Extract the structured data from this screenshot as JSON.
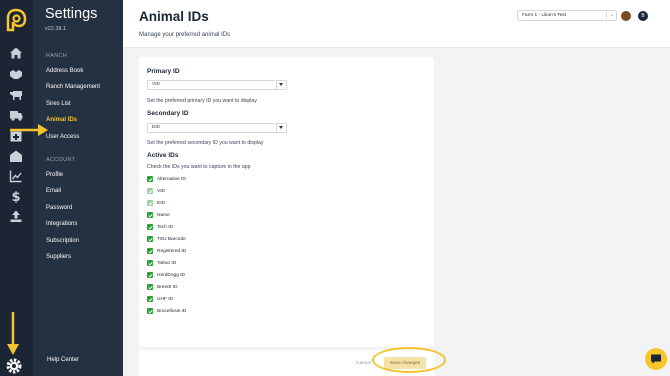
{
  "sidebar": {
    "title": "Settings",
    "version": "v22.38.1",
    "ranch_label": "RANCH",
    "account_label": "ACCOUNT",
    "ranch_items": [
      {
        "label": "Address Book"
      },
      {
        "label": "Ranch Management"
      },
      {
        "label": "Sires List"
      },
      {
        "label": "Animal IDs",
        "active": true
      },
      {
        "label": "User Access"
      }
    ],
    "account_items": [
      {
        "label": "Profile"
      },
      {
        "label": "Email"
      },
      {
        "label": "Password"
      },
      {
        "label": "Integrations"
      },
      {
        "label": "Subscription"
      },
      {
        "label": "Suppliers"
      }
    ],
    "help_center": "Help Center",
    "rail_icons": [
      "home-icon",
      "handshake-icon",
      "cow-icon",
      "truck-icon",
      "medical-box-icon",
      "barn-icon",
      "chart-icon",
      "dollar-icon",
      "upload-icon"
    ]
  },
  "header": {
    "title": "Animal IDs",
    "subtitle": "Manage your preferred animal IDs",
    "farm_select": "Farm 1 - Lilian's Test",
    "user_initial": "B"
  },
  "form": {
    "primary": {
      "label": "Primary ID",
      "value": "VID",
      "helper": "Set the preferred primary ID you want to display"
    },
    "secondary": {
      "label": "Secondary ID",
      "value": "EID",
      "helper": "Set the preferred secondary ID you want to display"
    },
    "active": {
      "label": "Active IDs",
      "helper": "Check the IDs you want to capture in the app",
      "items": [
        {
          "label": "Alternative ID",
          "checked": true,
          "disabled": false
        },
        {
          "label": "VID",
          "checked": true,
          "disabled": true
        },
        {
          "label": "EID",
          "checked": true,
          "disabled": true
        },
        {
          "label": "Name",
          "checked": true,
          "disabled": false
        },
        {
          "label": "Tsch ID",
          "checked": true,
          "disabled": false
        },
        {
          "label": "TSU Barcode",
          "checked": true,
          "disabled": false
        },
        {
          "label": "Registered ID",
          "checked": true,
          "disabled": false
        },
        {
          "label": "Tattoo ID",
          "checked": true,
          "disabled": false
        },
        {
          "label": "HerdDogg ID",
          "checked": true,
          "disabled": false
        },
        {
          "label": "Breedr ID",
          "checked": true,
          "disabled": false
        },
        {
          "label": "UHF ID",
          "checked": true,
          "disabled": false
        },
        {
          "label": "Brucellosis ID",
          "checked": true,
          "disabled": false
        }
      ]
    },
    "cancel_label": "Cancel",
    "save_label": "Save changes"
  },
  "colors": {
    "accent": "#f6c62b",
    "rail": "#1b2533",
    "panel": "#243142",
    "check": "#2e9d3d"
  }
}
